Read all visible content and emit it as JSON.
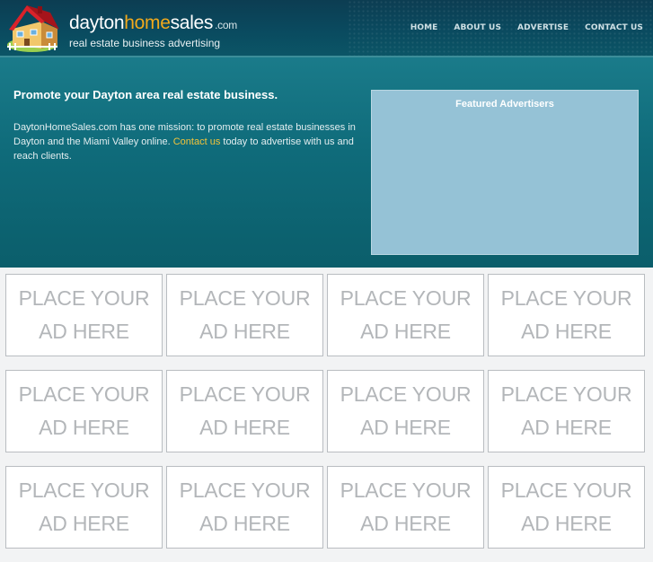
{
  "header": {
    "logo": {
      "name_part1": "dayton",
      "name_part2": "home",
      "name_part3": "sales",
      "tld": ".com",
      "tagline": "real estate business advertising",
      "icon": "house-icon"
    },
    "nav": [
      {
        "label": "HOME"
      },
      {
        "label": "ABOUT US"
      },
      {
        "label": "ADVERTISE"
      },
      {
        "label": "CONTACT US"
      }
    ]
  },
  "hero": {
    "heading": "Promote your Dayton area real estate business.",
    "body_before": "DaytonHomeSales.com has one mission: to promote real estate businesses in Dayton and the Miami Valley online. ",
    "link_text": "Contact us",
    "body_after": " today to advertise with us and reach clients."
  },
  "featured": {
    "title": "Featured Advertisers"
  },
  "ads": {
    "line1": "PLACE YOUR",
    "line2": "AD HERE"
  },
  "colors": {
    "header_bg": "#0c3d52",
    "hero_bg": "#0f6b7a",
    "accent_orange": "#f1a91c",
    "link_yellow": "#f3c33a",
    "featured_bg": "#95c2d6",
    "ad_text": "#b3b6b9"
  }
}
